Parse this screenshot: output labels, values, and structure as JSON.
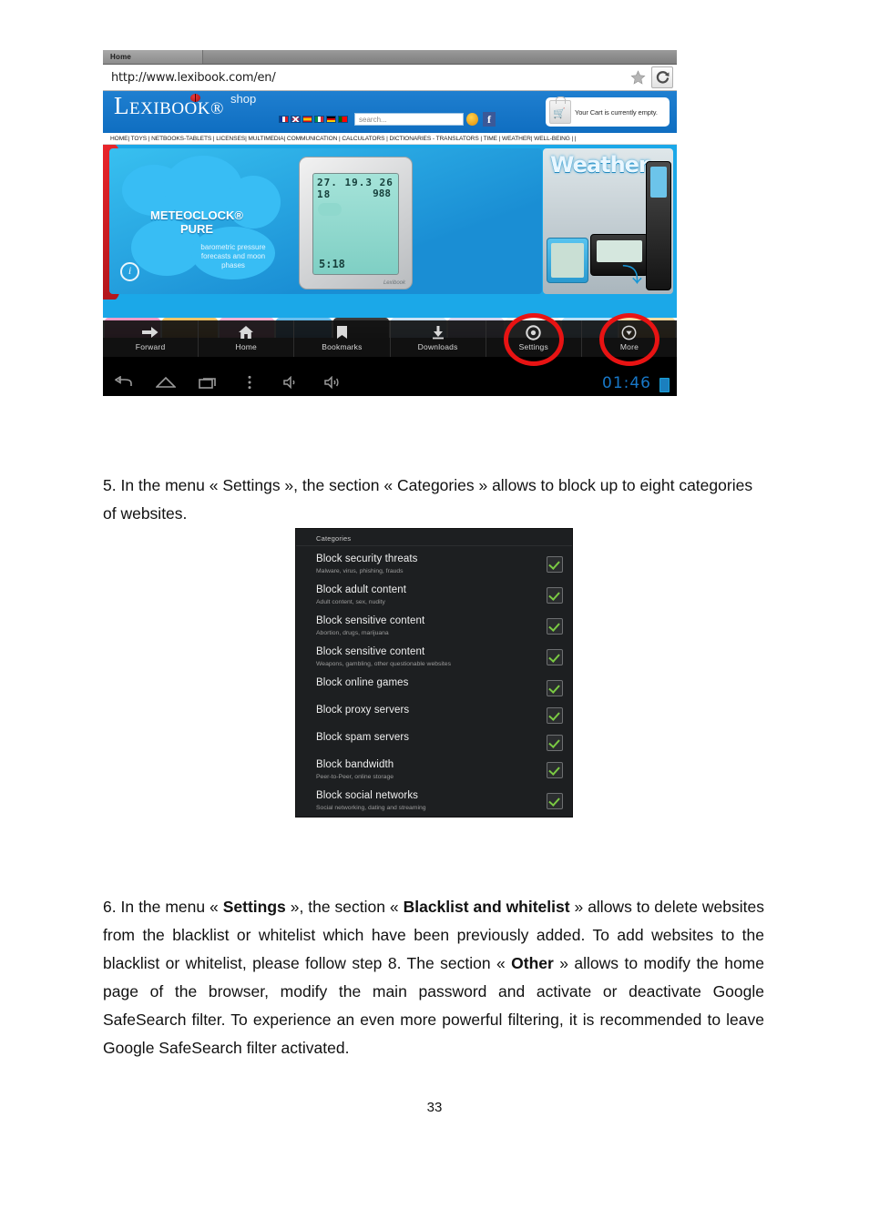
{
  "document": {
    "page_number": "33"
  },
  "figure_browser": {
    "tab_label": "Home",
    "url": "http://www.lexibook.com/en/",
    "star_icon": "bookmark-star-icon",
    "reload_icon": "reload-icon",
    "site": {
      "logo_main": "EXIBOOK",
      "logo_first_letter": "L",
      "logo_registered": "®",
      "logo_shop": "shop",
      "search_placeholder": "search...",
      "facebook_label": "f",
      "cart_text": "Your Cart is currently empty.",
      "languages": [
        "French",
        "English",
        "Spanish",
        "Italian",
        "German",
        "Portuguese"
      ],
      "nav": "HOME| TOYS | NETBOOKS-TABLETS | LICENSES| MULTIMEDIA| COMMUNICATION | CALCULATORS | DICTIONARIES - TRANSLATORS | TIME | WEATHER| WELL-BEING |  |"
    },
    "hero": {
      "product_name": "METEOCLOCK®",
      "product_variant": "PURE",
      "product_desc": "barometric pressure forecasts and moon phases",
      "side_title": "Weather",
      "device_line1": "27. 19.3 26  18",
      "device_line2": "988",
      "device_line3": "5:18",
      "device_brand": "Lexibook",
      "info_icon": "info-icon"
    },
    "dock": [
      {
        "label": "Forward",
        "icon": "forward-arrow-icon",
        "highlighted": false
      },
      {
        "label": "Home",
        "icon": "home-icon",
        "highlighted": false
      },
      {
        "label": "Bookmarks",
        "icon": "bookmark-icon",
        "highlighted": false
      },
      {
        "label": "Downloads",
        "icon": "download-icon",
        "highlighted": false
      },
      {
        "label": "Settings",
        "icon": "settings-gear-icon",
        "highlighted": true
      },
      {
        "label": "More",
        "icon": "more-chevron-icon",
        "highlighted": true
      }
    ],
    "system_bar": {
      "icons": [
        "back-icon",
        "home-icon",
        "recents-icon",
        "menu-dots-icon",
        "volume-down-icon",
        "volume-up-icon"
      ],
      "clock": "01:46",
      "battery_icon": "battery-icon"
    }
  },
  "text": {
    "step5": "5. In the menu « Settings », the section « Categories » allows to block up to eight categories of websites.",
    "step6_part1": "6. In the menu « ",
    "step6_bold1": "Settings",
    "step6_part2": " », the section « ",
    "step6_bold2": "Blacklist and whitelist",
    "step6_part3": " » allows to delete websites from the blacklist or whitelist which have been previously added. To add websites to the blacklist or whitelist, please follow step 8. The section « ",
    "step6_bold3": "Other",
    "step6_part4": " » allows to modify the home page of the browser, modify the main password and activate or deactivate Google SafeSearch filter. To experience an even more powerful filtering, it is recommended to leave Google SafeSearch filter activated."
  },
  "figure_categories": {
    "section_header": "Categories",
    "rows": [
      {
        "title": "Block security threats",
        "desc": "Malware, virus, phishing, frauds",
        "checked": true
      },
      {
        "title": "Block adult content",
        "desc": "Adult content, sex, nudity",
        "checked": true
      },
      {
        "title": "Block sensitive content",
        "desc": "Abortion, drugs, marijuana",
        "checked": true
      },
      {
        "title": "Block sensitive content",
        "desc": "Weapons, gambling, other questionable websites",
        "checked": true
      },
      {
        "title": "Block online games",
        "desc": "",
        "checked": true
      },
      {
        "title": "Block proxy servers",
        "desc": "",
        "checked": true
      },
      {
        "title": "Block spam servers",
        "desc": "",
        "checked": true
      },
      {
        "title": "Block bandwidth",
        "desc": "Peer-to-Peer, online storage",
        "checked": true
      },
      {
        "title": "Block social networks",
        "desc": "Social networking, dating and streaming",
        "checked": true
      }
    ]
  },
  "colors": {
    "accent_blue": "#1478c8",
    "highlight_red": "#e81313",
    "check_green": "#7ac943",
    "panel_bg": "#1d1f21"
  }
}
